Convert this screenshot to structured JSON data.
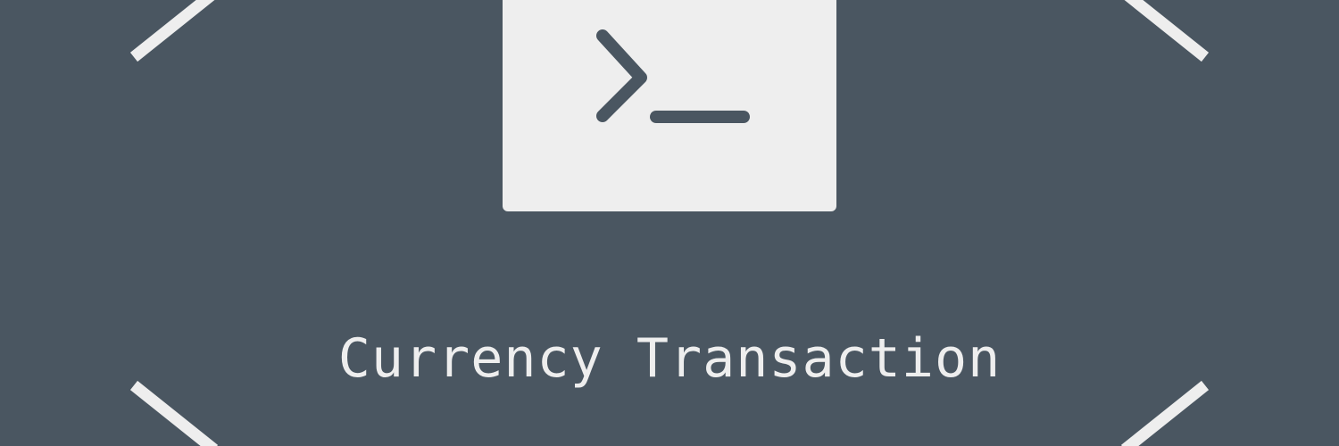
{
  "banner": {
    "title": "Currency Transaction",
    "icon": "terminal-prompt-icon",
    "colors": {
      "background": "#4a5661",
      "foreground": "#eeeeee"
    }
  }
}
